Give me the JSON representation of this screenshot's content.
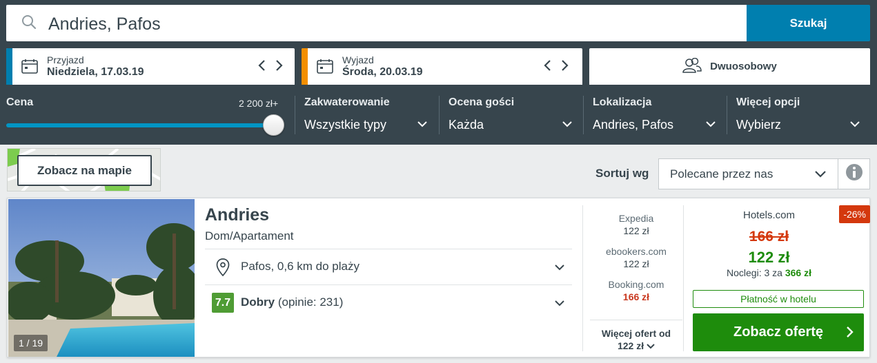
{
  "search": {
    "query": "Andries, Pafos",
    "button_label": "Szukaj"
  },
  "dates": {
    "checkin_label": "Przyjazd",
    "checkin_value": "Niedziela, 17.03.19",
    "checkout_label": "Wyjazd",
    "checkout_value": "Środa, 20.03.19",
    "room_label": "Dwuosobowy"
  },
  "filters": {
    "price_label": "Cena",
    "price_max": "2 200 zł+",
    "price_slider_level": 1.0,
    "accommodation_label": "Zakwaterowanie",
    "accommodation_value": "Wszystkie typy",
    "rating_label": "Ocena gości",
    "rating_value": "Każda",
    "location_label": "Lokalizacja",
    "location_value": "Andries, Pafos",
    "more_label": "Więcej opcji",
    "more_value": "Wybierz"
  },
  "toolbar": {
    "map_button": "Zobacz na mapie",
    "sort_label": "Sortuj wg",
    "sort_value": "Polecane przez nas"
  },
  "result": {
    "photo_counter": "1 / 19",
    "name": "Andries",
    "type": "Dom/Apartament",
    "location": "Pafos, 0,6 km do plaży",
    "rating_score": "7.7",
    "rating_word": "Dobry",
    "rating_reviews": "(opinie: 231)",
    "offers": [
      {
        "provider": "Expedia",
        "price": "122 zł",
        "highlight": false
      },
      {
        "provider": "ebookers.com",
        "price": "122 zł",
        "highlight": false
      },
      {
        "provider": "Booking.com",
        "price": "166 zł",
        "highlight": true
      }
    ],
    "more_offers_line1": "Więcej ofert od",
    "more_offers_line2": "122 zł",
    "deal": {
      "discount": "-26%",
      "provider": "Hotels.com",
      "old_price": "166 zł",
      "new_price": "122 zł",
      "nights_text": "Noclegi: 3 za",
      "nights_total": "366 zł",
      "pay_at_hotel": "Płatność w hotelu",
      "cta_label": "Zobacz ofertę"
    }
  },
  "colors": {
    "header_bg": "#37454d",
    "search_button": "#007faf",
    "checkin_accent": "#007faf",
    "checkout_accent": "#f48f00",
    "slider": "#0195c4",
    "rating_badge": "#4f9c34",
    "price_green": "#1e8c0c",
    "price_red": "#d4380d"
  }
}
